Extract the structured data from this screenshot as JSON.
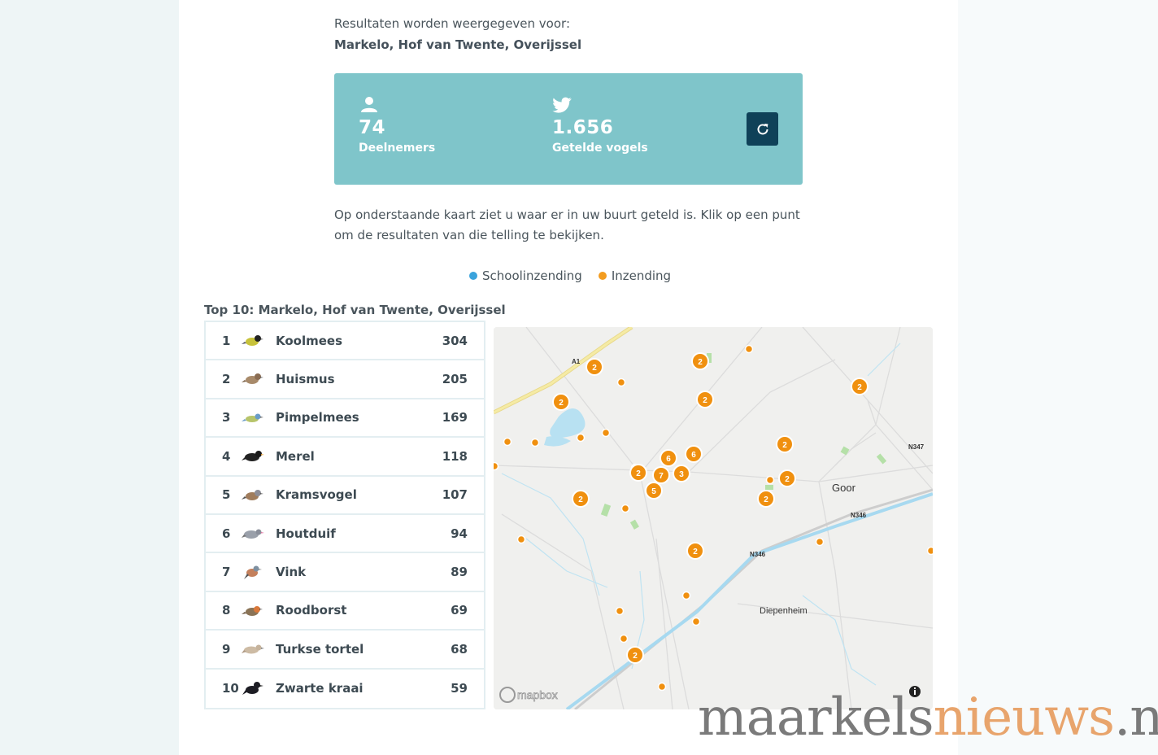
{
  "header": {
    "results_label": "Resultaten worden weergegeven voor:",
    "location": "Markelo, Hof van Twente, Overijssel"
  },
  "stats": {
    "participants": {
      "icon": "person-icon",
      "value": "74",
      "label": "Deelnemers"
    },
    "birds": {
      "icon": "twitter-bird-icon",
      "value": "1.656",
      "label": "Getelde vogels"
    },
    "refresh_icon": "refresh-icon",
    "card_color": "#7fc5ca",
    "button_color": "#0f4158"
  },
  "intro_text": "Op onderstaande kaart ziet u waar er in uw buurt geteld is. Klik op een punt om de resultaten van die telling te bekijken.",
  "legend": {
    "school": {
      "label": "Schoolinzending",
      "color": "#3aa3dc"
    },
    "submission": {
      "label": "Inzending",
      "color": "#f39c1f"
    }
  },
  "top10": {
    "title": "Top 10: Markelo, Hof van Twente, Overijssel",
    "rows": [
      {
        "rank": "1",
        "name": "Koolmees",
        "count": "304"
      },
      {
        "rank": "2",
        "name": "Huismus",
        "count": "205"
      },
      {
        "rank": "3",
        "name": "Pimpelmees",
        "count": "169"
      },
      {
        "rank": "4",
        "name": "Merel",
        "count": "118"
      },
      {
        "rank": "5",
        "name": "Kramsvogel",
        "count": "107"
      },
      {
        "rank": "6",
        "name": "Houtduif",
        "count": "94"
      },
      {
        "rank": "7",
        "name": "Vink",
        "count": "89"
      },
      {
        "rank": "8",
        "name": "Roodborst",
        "count": "69"
      },
      {
        "rank": "9",
        "name": "Turkse tortel",
        "count": "68"
      },
      {
        "rank": "10",
        "name": "Zwarte kraai",
        "count": "59"
      }
    ]
  },
  "map": {
    "labels": {
      "a1": "A1",
      "n347": "N347",
      "n346a": "N346",
      "n346b": "N346",
      "goor": "Goor",
      "diepenheim": "Diepenheim",
      "attribution": "mapbox"
    },
    "cluster_counts": [
      "2",
      "2",
      "2",
      "2",
      "2",
      "6",
      "6",
      "7",
      "3",
      "5",
      "2",
      "2",
      "2",
      "2",
      "2",
      "2",
      "2"
    ],
    "info_icon": "info-icon"
  },
  "watermark": {
    "part1": "maarkels",
    "part2": "nieuws",
    "part3": ".nl"
  }
}
